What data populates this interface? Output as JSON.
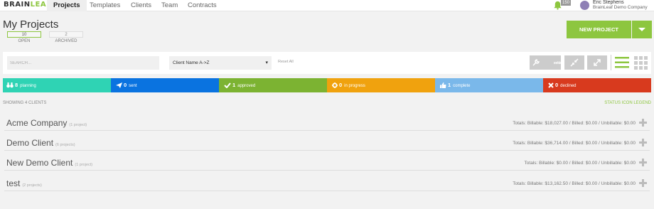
{
  "brand": {
    "logo_part1": "BRAIN",
    "logo_part2": "LEAF"
  },
  "nav": {
    "tabs": [
      {
        "label": "Projects",
        "active": true
      },
      {
        "label": "Templates"
      },
      {
        "label": "Clients"
      },
      {
        "label": "Team"
      },
      {
        "label": "Contracts"
      }
    ]
  },
  "user": {
    "name": "Eric Stephens",
    "company": "BrainLeaf Demo Company",
    "notifications": "150"
  },
  "page": {
    "title": "My Projects",
    "views": [
      {
        "count": "10",
        "label": "OPEN",
        "active": true
      },
      {
        "count": "2",
        "label": "ARCHIVED"
      }
    ],
    "new_button": "NEW PROJECT"
  },
  "filters": {
    "search_placeholder": "SEARCH...",
    "sort_value": "Client Name A->Z",
    "reset_label": "Reset All",
    "column_settings_line1": "column",
    "column_settings_line2": "settings"
  },
  "statuses": [
    {
      "count": "8",
      "label": "planning",
      "color": "#2fd3b4",
      "icon": "binoculars-icon"
    },
    {
      "count": "0",
      "label": "sent",
      "color": "#0a73e0",
      "icon": "paper-plane-icon"
    },
    {
      "count": "1",
      "label": "approved",
      "color": "#7cb332",
      "icon": "check-icon"
    },
    {
      "count": "0",
      "label": "in progress",
      "color": "#f0a20e",
      "icon": "gear-icon"
    },
    {
      "count": "1",
      "label": "complete",
      "color": "#7ab8ea",
      "icon": "thumbs-up-icon"
    },
    {
      "count": "0",
      "label": "declined",
      "color": "#d83a1e",
      "icon": "x-icon"
    }
  ],
  "summary": {
    "showing": "SHOWING 4 CLIENTS",
    "legend_link": "STATUS ICON LEGEND"
  },
  "clients": [
    {
      "name": "Acme Company",
      "projects": "(1 project)",
      "totals": "Totals: Billable: $18,027.00 / Billed: $0.00 / Unbillable: $0.00"
    },
    {
      "name": "Demo Client",
      "projects": "(6 projects)",
      "totals": "Totals: Billable: $36,714.00 / Billed: $0.00 / Unbillable: $0.00"
    },
    {
      "name": "New Demo Client",
      "projects": "(1 project)",
      "totals": "Totals: Billable: $0.00 / Billed: $0.00 / Unbillable: $0.00"
    },
    {
      "name": "test",
      "projects": "(2 projects)",
      "totals": "Totals: Billable: $13,162.50 / Billed: $0.00 / Unbillable: $0.00"
    }
  ],
  "colors": {
    "accent": "#8dc63f"
  }
}
